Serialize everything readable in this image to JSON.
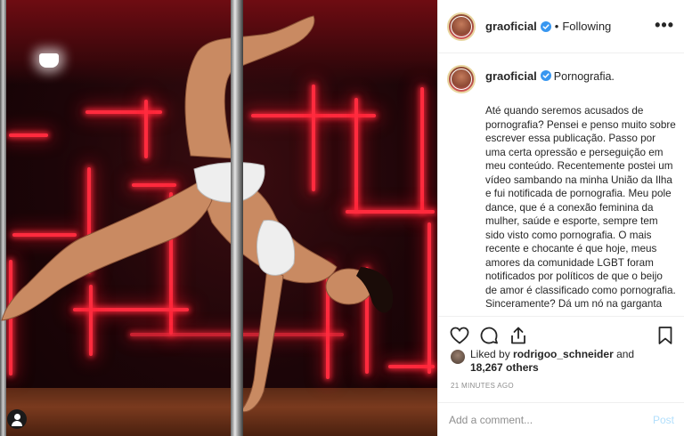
{
  "post": {
    "username": "graoficial",
    "follow_status": "Following",
    "separator": "•",
    "more_label": "•••",
    "caption_title": "Pornografia.",
    "caption_body": "Até quando seremos acusados de pornografia? Pensei e penso muito sobre escrever essa publicação. Passo por uma certa opressão e perseguição em meu conteúdo. Recentemente postei um vídeo sambando na minha União da Ilha e fui notificada de pornografia. Meu pole dance, que é a conexão feminina da mulher, saúde e esporte, sempre tem sido visto como pornografia. O mais recente e chocante é que hoje, meus amores da comunidade LGBT foram notificados por políticos de que o beijo de amor é classificado como pornografia. Sinceramente? Dá um nó na garganta",
    "liked_by_prefix": "Liked by",
    "liked_by_user": "rodrigoo_schneider",
    "liked_by_and": "and",
    "likes_count": "18,267 others",
    "timestamp": "21 MINUTES AGO",
    "comment_placeholder": "Add a comment...",
    "post_button": "Post"
  },
  "icons": {
    "verified": "verified-badge-icon",
    "like": "heart-icon",
    "comment": "comment-icon",
    "share": "share-icon",
    "save": "bookmark-icon",
    "tagged_user": "user-icon"
  },
  "colors": {
    "verified_blue": "#3897f0",
    "neon_red": "#ff2b3e",
    "post_disabled": "#b2dffc",
    "muted_text": "#8e8e8e"
  }
}
